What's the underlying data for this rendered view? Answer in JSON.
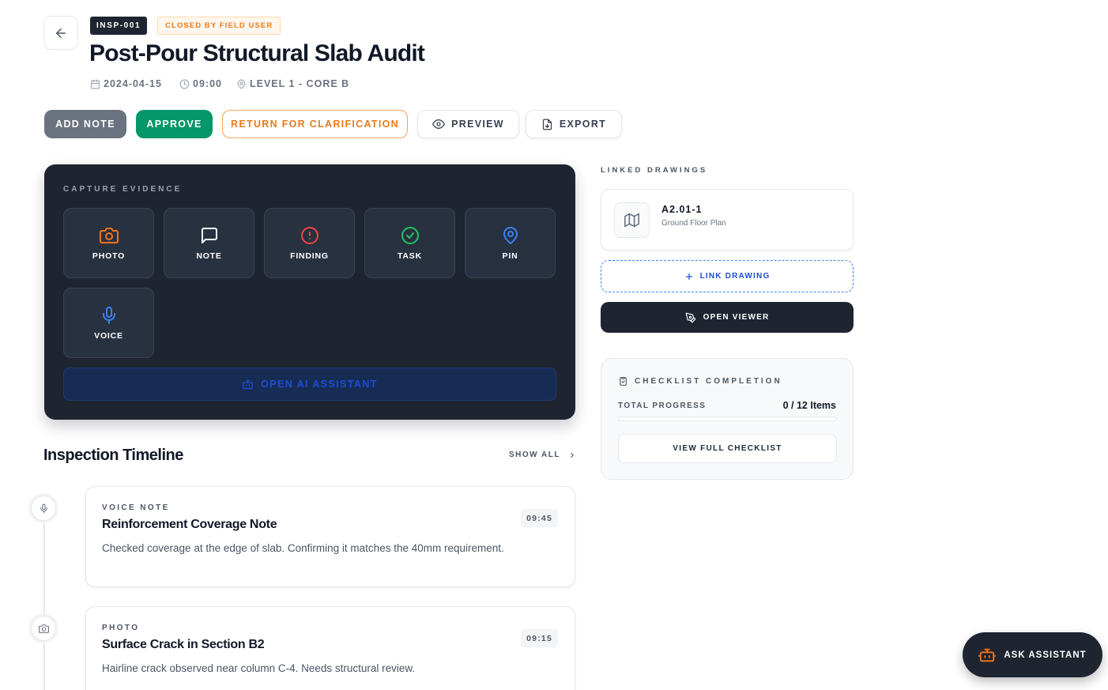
{
  "header": {
    "id_badge": "INSP-001",
    "status_badge": "CLOSED BY FIELD USER",
    "title": "Post-Pour Structural Slab Audit",
    "date": "2024-04-15",
    "time": "09:00",
    "location": "LEVEL 1 - CORE B"
  },
  "actions": {
    "add_note": "ADD NOTE",
    "approve": "APPROVE",
    "return": "RETURN FOR CLARIFICATION",
    "preview": "PREVIEW",
    "export": "EXPORT"
  },
  "capture": {
    "label": "CAPTURE EVIDENCE",
    "tiles": [
      {
        "label": "PHOTO",
        "icon": "camera-icon",
        "color": "#f97316"
      },
      {
        "label": "NOTE",
        "icon": "message-square-icon",
        "color": "#ffffff"
      },
      {
        "label": "FINDING",
        "icon": "alert-circle-icon",
        "color": "#ef4444"
      },
      {
        "label": "TASK",
        "icon": "check-circle-icon",
        "color": "#22c55e"
      },
      {
        "label": "PIN",
        "icon": "map-pin-icon",
        "color": "#3b82f6"
      },
      {
        "label": "VOICE",
        "icon": "mic-icon",
        "color": "#3b82f6"
      }
    ],
    "ai_button": "OPEN AI ASSISTANT"
  },
  "timeline": {
    "title": "Inspection Timeline",
    "show_all": "SHOW ALL",
    "items": [
      {
        "type": "VOICE NOTE",
        "icon": "mic-icon",
        "title": "Reinforcement Coverage Note",
        "description": "Checked coverage at the edge of slab. Confirming it matches the 40mm requirement.",
        "time": "09:45"
      },
      {
        "type": "PHOTO",
        "icon": "camera-icon",
        "title": "Surface Crack in Section B2",
        "description": "Hairline crack observed near column C-4. Needs structural review.",
        "time": "09:15"
      }
    ]
  },
  "linked_drawings": {
    "label": "LINKED DRAWINGS",
    "drawing": {
      "code": "A2.01-1",
      "name": "Ground Floor Plan",
      "icon": "map-icon"
    },
    "link_button": "LINK DRAWING",
    "viewer_button": "OPEN VIEWER"
  },
  "checklist": {
    "title": "CHECKLIST COMPLETION",
    "progress_label": "TOTAL PROGRESS",
    "progress_value": "0 / 12 Items",
    "progress_fraction": 0,
    "view_button": "VIEW FULL CHECKLIST"
  },
  "assistant": {
    "label": "ASK ASSISTANT",
    "icon": "bot-icon"
  },
  "colors": {
    "dark": "#1e2530",
    "approve": "#059669",
    "return": "#ea7a1a",
    "accent_blue": "#1d4ed8",
    "orange": "#f97316"
  }
}
